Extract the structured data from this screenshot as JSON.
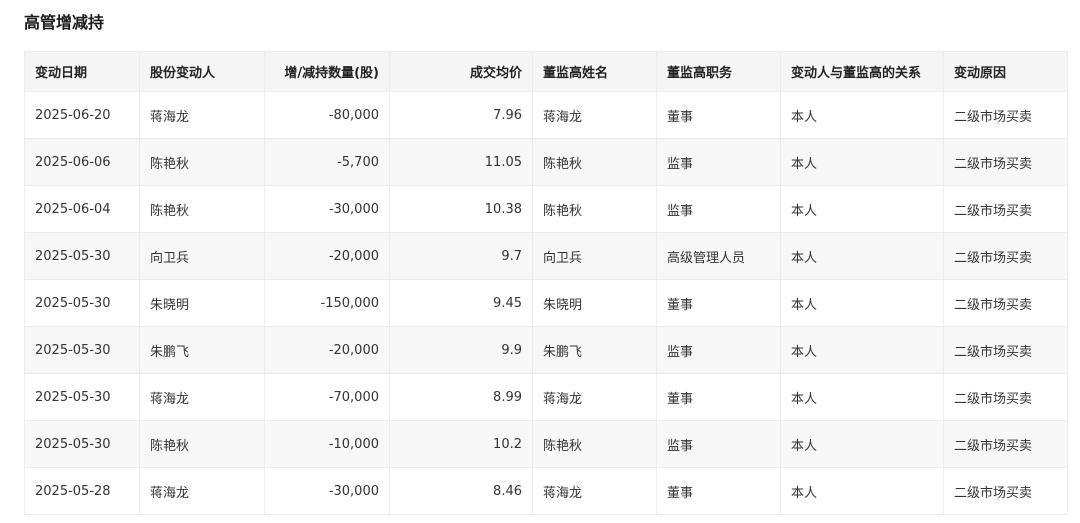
{
  "section": {
    "title": "高管增减持"
  },
  "table": {
    "columns": [
      "变动日期",
      "股份变动人",
      "增/减持数量(股)",
      "成交均价",
      "董监高姓名",
      "董监高职务",
      "变动人与董监高的关系",
      "变动原因"
    ],
    "rows": [
      [
        "2025-06-20",
        "蒋海龙",
        "-80,000",
        "7.96",
        "蒋海龙",
        "董事",
        "本人",
        "二级市场买卖"
      ],
      [
        "2025-06-06",
        "陈艳秋",
        "-5,700",
        "11.05",
        "陈艳秋",
        "监事",
        "本人",
        "二级市场买卖"
      ],
      [
        "2025-06-04",
        "陈艳秋",
        "-30,000",
        "10.38",
        "陈艳秋",
        "监事",
        "本人",
        "二级市场买卖"
      ],
      [
        "2025-05-30",
        "向卫兵",
        "-20,000",
        "9.7",
        "向卫兵",
        "高级管理人员",
        "本人",
        "二级市场买卖"
      ],
      [
        "2025-05-30",
        "朱晓明",
        "-150,000",
        "9.45",
        "朱晓明",
        "董事",
        "本人",
        "二级市场买卖"
      ],
      [
        "2025-05-30",
        "朱鹏飞",
        "-20,000",
        "9.9",
        "朱鹏飞",
        "监事",
        "本人",
        "二级市场买卖"
      ],
      [
        "2025-05-30",
        "蒋海龙",
        "-70,000",
        "8.99",
        "蒋海龙",
        "董事",
        "本人",
        "二级市场买卖"
      ],
      [
        "2025-05-30",
        "陈艳秋",
        "-10,000",
        "10.2",
        "陈艳秋",
        "监事",
        "本人",
        "二级市场买卖"
      ],
      [
        "2025-05-28",
        "蒋海龙",
        "-30,000",
        "8.46",
        "蒋海龙",
        "董事",
        "本人",
        "二级市场买卖"
      ]
    ]
  }
}
